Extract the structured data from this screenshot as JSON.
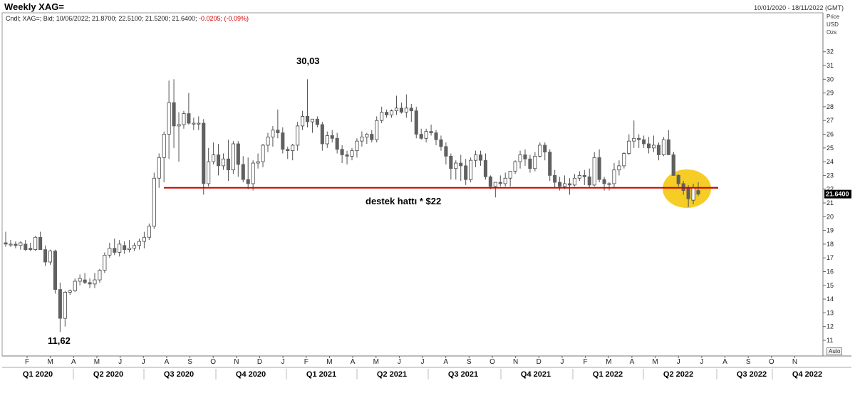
{
  "header": {
    "title": "Weekly XAG=",
    "date_range": "10/01/2020 - 18/11/2022 (GMT)",
    "series_info": "Cndl; XAG=; Bid; 10/06/2022; 21.8700; 22.5100; 21.5200; 21.6400;",
    "change_info": "-0.0205; (-0.09%)",
    "units": [
      "Price",
      "USD",
      "Ozs"
    ],
    "auto_button": "Auto"
  },
  "chart_data": {
    "type": "candlestick",
    "title": "Weekly XAG=",
    "ylim": [
      10.5,
      33
    ],
    "yticks": [
      11,
      12,
      13,
      14,
      15,
      16,
      17,
      18,
      19,
      20,
      21,
      22,
      23,
      24,
      25,
      26,
      27,
      28,
      29,
      30,
      31,
      32
    ],
    "last_price_label": "21.6400",
    "last_price": 21.64,
    "month_labels": [
      "F",
      "M",
      "A",
      "M",
      "J",
      "J",
      "A",
      "S",
      "O",
      "N",
      "D",
      "J",
      "F",
      "M",
      "A",
      "M",
      "J",
      "J",
      "A",
      "S",
      "O",
      "N",
      "D",
      "J",
      "F",
      "M",
      "A",
      "M",
      "J",
      "J",
      "A",
      "S",
      "O",
      "N"
    ],
    "quarter_labels": [
      "Q1 2020",
      "Q2 2020",
      "Q3 2020",
      "Q4 2020",
      "Q1 2021",
      "Q2 2021",
      "Q3 2021",
      "Q4 2021",
      "Q1 2022",
      "Q2 2022",
      "Q3 2022",
      "Q4 2022"
    ],
    "annotations": {
      "high_label": "30,03",
      "low_label": "11,62",
      "support_label": "destek hattı * $22",
      "support_level": 22.1
    },
    "candles": [
      [
        18.1,
        18.9,
        17.8,
        18.0
      ],
      [
        18.0,
        18.3,
        17.8,
        18.0
      ],
      [
        18.0,
        18.2,
        17.7,
        17.9
      ],
      [
        17.9,
        18.2,
        17.6,
        18.1
      ],
      [
        18.0,
        18.3,
        17.5,
        17.6
      ],
      [
        17.7,
        18.1,
        17.5,
        17.6
      ],
      [
        17.6,
        18.6,
        17.5,
        18.5
      ],
      [
        18.5,
        18.9,
        17.6,
        17.6
      ],
      [
        17.6,
        17.9,
        16.4,
        16.7
      ],
      [
        16.7,
        17.6,
        16.5,
        17.5
      ],
      [
        17.5,
        17.6,
        14.4,
        14.7
      ],
      [
        14.7,
        15.2,
        11.6,
        12.6
      ],
      [
        12.6,
        14.6,
        12.0,
        14.5
      ],
      [
        14.5,
        14.7,
        14.3,
        14.6
      ],
      [
        14.6,
        15.5,
        14.5,
        15.3
      ],
      [
        15.3,
        15.8,
        15.0,
        15.5
      ],
      [
        15.4,
        15.9,
        15.1,
        15.2
      ],
      [
        15.2,
        15.5,
        14.8,
        15.1
      ],
      [
        15.1,
        15.9,
        14.8,
        15.4
      ],
      [
        15.4,
        16.2,
        15.2,
        16.1
      ],
      [
        16.1,
        17.4,
        15.9,
        17.2
      ],
      [
        17.2,
        18.1,
        17.0,
        17.7
      ],
      [
        17.7,
        18.4,
        17.2,
        17.4
      ],
      [
        17.4,
        18.3,
        17.1,
        18.0
      ],
      [
        17.9,
        18.2,
        17.3,
        17.6
      ],
      [
        17.6,
        18.3,
        17.4,
        17.7
      ],
      [
        17.7,
        18.1,
        17.5,
        17.9
      ],
      [
        17.9,
        18.4,
        17.6,
        18.2
      ],
      [
        18.2,
        18.9,
        17.7,
        18.5
      ],
      [
        18.5,
        19.5,
        18.3,
        19.3
      ],
      [
        19.3,
        23.2,
        19.1,
        22.8
      ],
      [
        22.8,
        24.6,
        22.1,
        24.3
      ],
      [
        24.3,
        26.2,
        22.5,
        26.0
      ],
      [
        26.0,
        29.9,
        24.2,
        28.3
      ],
      [
        28.3,
        30.0,
        25.0,
        26.6
      ],
      [
        26.6,
        27.6,
        24.0,
        26.7
      ],
      [
        26.7,
        27.7,
        26.4,
        27.5
      ],
      [
        27.5,
        29.0,
        26.7,
        26.8
      ],
      [
        26.8,
        27.2,
        26.3,
        26.8
      ],
      [
        26.8,
        27.3,
        26.3,
        26.8
      ],
      [
        26.8,
        27.1,
        21.6,
        22.4
      ],
      [
        22.4,
        25.0,
        22.2,
        24.0
      ],
      [
        24.0,
        25.4,
        23.8,
        24.5
      ],
      [
        24.5,
        25.3,
        23.0,
        23.7
      ],
      [
        23.7,
        24.6,
        23.4,
        24.2
      ],
      [
        24.2,
        25.6,
        22.6,
        23.4
      ],
      [
        23.4,
        25.5,
        23.1,
        25.3
      ],
      [
        25.3,
        25.5,
        22.9,
        23.8
      ],
      [
        23.8,
        24.4,
        22.5,
        22.7
      ],
      [
        22.7,
        24.3,
        22.0,
        22.4
      ],
      [
        22.4,
        24.1,
        21.9,
        23.9
      ],
      [
        23.9,
        24.6,
        23.5,
        24.0
      ],
      [
        24.0,
        25.3,
        23.6,
        25.2
      ],
      [
        25.2,
        26.1,
        24.7,
        25.8
      ],
      [
        25.8,
        26.6,
        25.1,
        26.3
      ],
      [
        26.3,
        27.8,
        25.7,
        26.1
      ],
      [
        26.1,
        26.5,
        24.6,
        24.9
      ],
      [
        24.9,
        25.1,
        24.2,
        24.8
      ],
      [
        24.8,
        25.3,
        24.1,
        25.2
      ],
      [
        25.2,
        26.9,
        24.8,
        26.6
      ],
      [
        26.6,
        27.7,
        26.3,
        27.3
      ],
      [
        27.3,
        30.0,
        26.5,
        26.9
      ],
      [
        26.9,
        27.1,
        26.1,
        27.1
      ],
      [
        27.1,
        27.3,
        26.5,
        26.7
      ],
      [
        26.7,
        26.9,
        24.8,
        25.3
      ],
      [
        25.3,
        26.2,
        25.0,
        25.9
      ],
      [
        25.9,
        26.3,
        25.4,
        25.7
      ],
      [
        25.7,
        26.1,
        24.6,
        24.9
      ],
      [
        24.9,
        25.2,
        23.9,
        24.5
      ],
      [
        24.5,
        24.8,
        23.8,
        24.4
      ],
      [
        24.4,
        25.0,
        24.1,
        24.8
      ],
      [
        24.8,
        25.7,
        24.3,
        25.5
      ],
      [
        25.5,
        26.2,
        25.1,
        25.8
      ],
      [
        25.8,
        26.1,
        25.3,
        26.0
      ],
      [
        26.0,
        26.3,
        25.4,
        25.6
      ],
      [
        25.6,
        27.3,
        25.4,
        27.0
      ],
      [
        27.0,
        28.0,
        26.8,
        27.6
      ],
      [
        27.6,
        27.8,
        27.2,
        27.4
      ],
      [
        27.4,
        27.8,
        27.2,
        27.7
      ],
      [
        27.7,
        28.8,
        27.4,
        27.9
      ],
      [
        27.9,
        28.3,
        27.5,
        27.6
      ],
      [
        27.6,
        28.9,
        27.2,
        27.9
      ],
      [
        27.9,
        28.2,
        26.9,
        27.7
      ],
      [
        27.7,
        28.0,
        25.7,
        26.0
      ],
      [
        26.0,
        26.4,
        25.6,
        25.7
      ],
      [
        25.7,
        26.4,
        25.4,
        26.2
      ],
      [
        26.2,
        26.7,
        25.9,
        26.1
      ],
      [
        26.1,
        26.3,
        25.2,
        25.6
      ],
      [
        25.6,
        25.9,
        24.8,
        25.1
      ],
      [
        25.1,
        25.4,
        23.8,
        24.4
      ],
      [
        24.4,
        24.6,
        22.7,
        23.5
      ],
      [
        23.5,
        24.1,
        22.7,
        23.9
      ],
      [
        23.9,
        24.5,
        22.6,
        23.7
      ],
      [
        23.7,
        24.2,
        22.3,
        22.7
      ],
      [
        22.7,
        24.3,
        22.5,
        24.1
      ],
      [
        24.1,
        24.8,
        23.6,
        24.5
      ],
      [
        24.5,
        24.8,
        23.7,
        24.1
      ],
      [
        24.1,
        24.6,
        22.7,
        22.9
      ],
      [
        22.9,
        23.0,
        22.0,
        22.2
      ],
      [
        22.2,
        22.5,
        21.4,
        22.5
      ],
      [
        22.5,
        23.0,
        22.2,
        22.4
      ],
      [
        22.4,
        23.2,
        22.2,
        22.8
      ],
      [
        22.8,
        23.3,
        22.2,
        23.3
      ],
      [
        23.3,
        24.1,
        23.1,
        24.0
      ],
      [
        24.0,
        24.8,
        23.5,
        24.5
      ],
      [
        24.5,
        24.9,
        23.7,
        24.2
      ],
      [
        24.2,
        24.5,
        23.2,
        23.5
      ],
      [
        23.5,
        24.7,
        23.3,
        24.4
      ],
      [
        24.4,
        25.4,
        24.3,
        25.2
      ],
      [
        25.2,
        25.4,
        24.1,
        24.7
      ],
      [
        24.7,
        24.9,
        22.6,
        23.0
      ],
      [
        23.0,
        23.4,
        22.1,
        22.5
      ],
      [
        22.5,
        22.9,
        21.9,
        22.2
      ],
      [
        22.2,
        23.0,
        22.0,
        22.4
      ],
      [
        22.4,
        22.8,
        21.6,
        22.3
      ],
      [
        22.3,
        23.1,
        22.2,
        22.8
      ],
      [
        22.8,
        23.3,
        22.6,
        23.0
      ],
      [
        23.0,
        23.4,
        22.3,
        22.9
      ],
      [
        22.9,
        23.5,
        22.1,
        22.3
      ],
      [
        22.3,
        24.7,
        22.2,
        24.3
      ],
      [
        24.3,
        24.9,
        22.5,
        22.7
      ],
      [
        22.7,
        22.9,
        21.9,
        22.4
      ],
      [
        22.4,
        22.5,
        21.9,
        22.4
      ],
      [
        22.4,
        23.9,
        22.1,
        23.4
      ],
      [
        23.4,
        24.1,
        23.0,
        23.7
      ],
      [
        23.7,
        24.7,
        23.5,
        24.6
      ],
      [
        24.6,
        26.0,
        24.5,
        25.5
      ],
      [
        25.5,
        27.0,
        25.0,
        25.7
      ],
      [
        25.7,
        26.0,
        25.0,
        25.6
      ],
      [
        25.6,
        25.9,
        25.0,
        25.3
      ],
      [
        25.3,
        25.8,
        24.6,
        25.0
      ],
      [
        25.0,
        25.9,
        24.7,
        25.2
      ],
      [
        25.2,
        25.4,
        24.1,
        24.5
      ],
      [
        24.5,
        25.8,
        24.4,
        25.6
      ],
      [
        25.6,
        26.3,
        24.8,
        24.5
      ],
      [
        24.5,
        24.7,
        23.2,
        23.0
      ],
      [
        23.0,
        23.1,
        22.2,
        22.4
      ],
      [
        22.4,
        22.6,
        21.6,
        21.9
      ],
      [
        22.1,
        22.3,
        20.7,
        21.3
      ],
      [
        21.2,
        22.4,
        20.9,
        22.1
      ],
      [
        21.9,
        22.5,
        21.5,
        21.64
      ]
    ]
  }
}
